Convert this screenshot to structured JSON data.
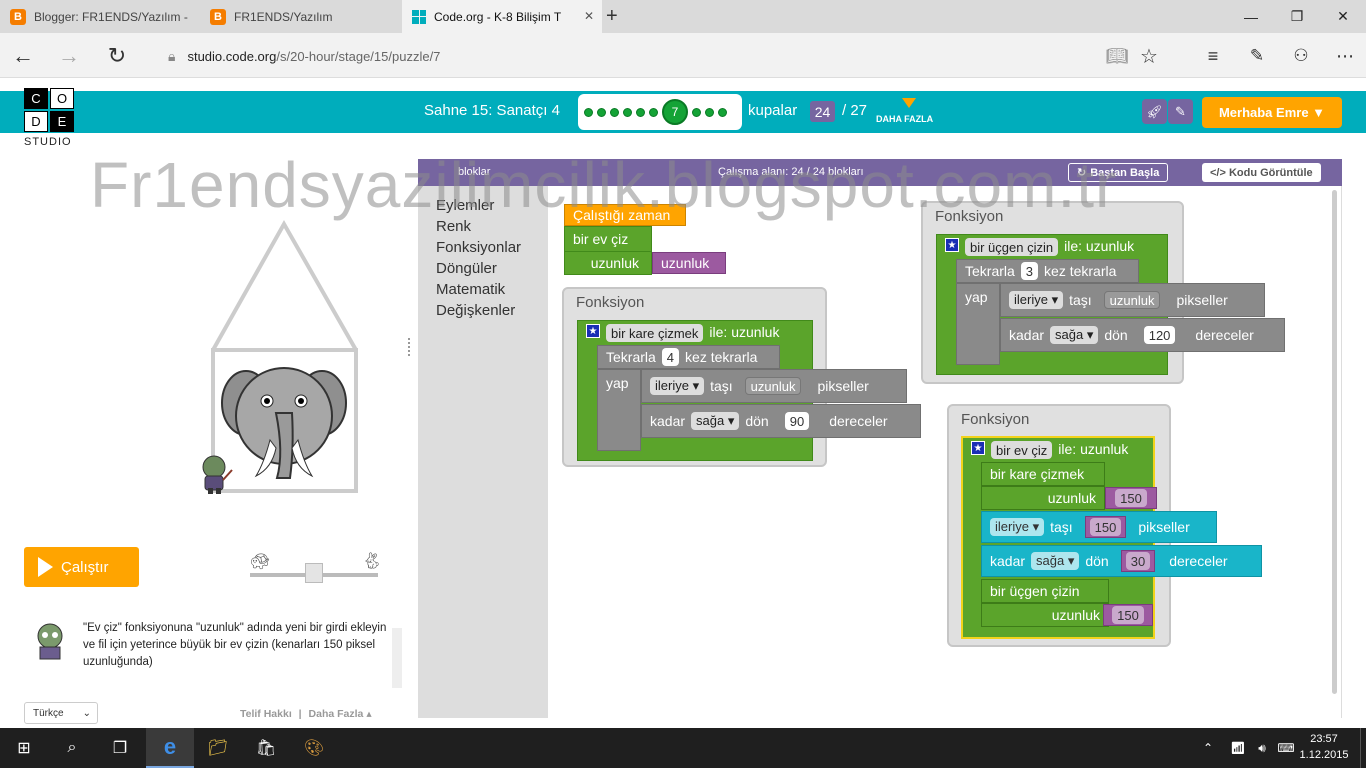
{
  "browser": {
    "tabs": [
      {
        "title": "Blogger: FR1ENDS/Yazılım -",
        "icon": "blogger-icon"
      },
      {
        "title": "FR1ENDS/Yazılım",
        "icon": "blogger-icon"
      },
      {
        "title": "Code.org - K-8 Bilişim T",
        "icon": "codeorg-icon",
        "active": true
      }
    ],
    "url_host": "studio.code.org",
    "url_path": "/s/20-hour/stage/15/puzzle/7"
  },
  "header": {
    "logo_letters": [
      "C",
      "O",
      "D",
      "E"
    ],
    "logo_sub": "STUDIO",
    "stage_title": "Sahne 15: Sanatçı 4",
    "current_puzzle": "7",
    "kupalar_label": "kupalar",
    "kupalar_count": "24",
    "kupalar_total": "/ 27",
    "daha_fazla": "DAHA FAZLA",
    "user_button": "Merhaba Emre ▼"
  },
  "watermark": "Fr1endsyazilimcilik.blogspot.com.tr",
  "left": {
    "run_label": "Çalıştır",
    "instruction": "\"Ev çiz\" fonksiyonuna \"uzunluk\" adında yeni bir girdi ekleyin ve fil için yeterince büyük bir ev çizin (kenarları 150 piksel uzunluğunda)",
    "language": "Türkçe",
    "footer_copyright": "Telif Hakkı",
    "footer_sep": "|",
    "footer_more": "Daha Fazla ▴"
  },
  "workspace": {
    "toolbox_header": "bloklar",
    "workspace_header": "Çalışma alanı: 24 / 24 blokları",
    "restart_label": "Baştan Başla",
    "show_code_label": "</> Kodu Görüntüle",
    "categories": [
      "Eylemler",
      "Renk",
      "Fonksiyonlar",
      "Döngüler",
      "Matematik",
      "Değişkenler"
    ],
    "when_run": "Çalıştığı zaman",
    "call_house": "bir ev çiz",
    "uzunluk": "uzunluk",
    "fonksiyon": "Fonksiyon",
    "square_fn": "bir kare çizmek",
    "triangle_fn": "bir üçgen çizin",
    "house_fn": "bir ev çiz",
    "ile_uzunluk": "ile: uzunluk",
    "tekrarla": "Tekrarla",
    "kez_tekrarla": "kez tekrarla",
    "yap": "yap",
    "ileriye": "ileriye ▾",
    "tasi": "taşı",
    "pikseller": "pikseller",
    "kadar": "kadar",
    "saga": "sağa ▾",
    "don": "dön",
    "dereceler": "dereceler",
    "square_repeat": "4",
    "square_angle": "90",
    "tri_repeat": "3",
    "tri_angle": "120",
    "house_len1": "150",
    "house_move": "150",
    "house_angle": "30",
    "house_len2": "150"
  },
  "taskbar": {
    "time": "23:57",
    "date": "1.12.2015"
  }
}
